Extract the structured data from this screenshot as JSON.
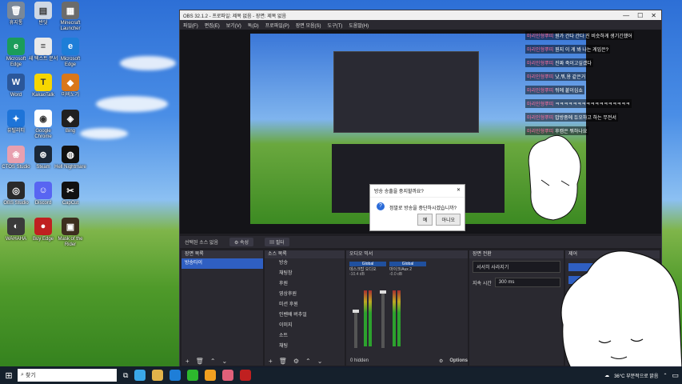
{
  "desktop_icons": [
    {
      "label": "휴지통",
      "color": "#7a8899",
      "glyph": "🗑"
    },
    {
      "label": "반딧",
      "color": "#cfd8e4",
      "glyph": "▤"
    },
    {
      "label": "Minecraft Launcher",
      "color": "#6b6b6b",
      "glyph": "▦"
    },
    {
      "label": "Microsoft Edge",
      "color": "#1b9c5a",
      "glyph": "e"
    },
    {
      "label": "새 텍스트 문서",
      "color": "#e9e9e9",
      "glyph": "≡"
    },
    {
      "label": "Microsoft Edge",
      "color": "#1e7ed8",
      "glyph": "e"
    },
    {
      "label": "Word",
      "color": "#2b579a",
      "glyph": "W"
    },
    {
      "label": "KakaoTalk",
      "color": "#f6d600",
      "glyph": "T"
    },
    {
      "label": "마비노기",
      "color": "#d9771a",
      "glyph": "◆"
    },
    {
      "label": "유틸리티",
      "color": "#1e74d8",
      "glyph": "✦"
    },
    {
      "label": "Google Chrome",
      "color": "#ffffff",
      "glyph": "◉"
    },
    {
      "label": "Bing",
      "color": "#202020",
      "glyph": "◈"
    },
    {
      "label": "CTOS Studio",
      "color": "#e8a0b0",
      "glyph": "❀"
    },
    {
      "label": "Steam",
      "color": "#1b2838",
      "glyph": "⊛"
    },
    {
      "label": "Hell Nightmare",
      "color": "#111111",
      "glyph": "◍"
    },
    {
      "label": "OBS Studio",
      "color": "#2a2a2a",
      "glyph": "◎"
    },
    {
      "label": "Discord",
      "color": "#5865f2",
      "glyph": "☺"
    },
    {
      "label": "CapCut",
      "color": "#111111",
      "glyph": "✂"
    },
    {
      "label": "WAHAHA",
      "color": "#3a3a3a",
      "glyph": "◐"
    },
    {
      "label": "Buy Edge",
      "color": "#c02020",
      "glyph": "●"
    },
    {
      "label": "Mask of the Rider",
      "color": "#3d2e1f",
      "glyph": "▣"
    }
  ],
  "obs": {
    "title": "OBS 32.1.2 - 프로파일: 제목 없음 - 장면: 제목 없음",
    "menu": [
      "파일(F)",
      "편집(E)",
      "보기(V)",
      "독(D)",
      "프로파일(P)",
      "장면 모음(S)",
      "도구(T)",
      "도움말(H)"
    ],
    "dialog": {
      "title": "방송 송출을 중지할까요?",
      "message": "정말로 방송을 중단하시겠습니까?",
      "yes": "예",
      "no": "아니오"
    },
    "chat": [
      {
        "nick": "마리인형뿌띠",
        "text": "뭔가 간다 간다 진 비슷하게 생기긴했어"
      },
      {
        "nick": "마리인형뿌띠",
        "text": "뭔지 이 게 봐 나는 게임은?"
      },
      {
        "nick": "마리인형뿌띠",
        "text": "진짜 죽이고싶겠다"
      },
      {
        "nick": "마리인형뿌띠",
        "text": "낫,뭐,용 같은거"
      },
      {
        "nick": "마리인형뿌띠",
        "text": "뒤에 붙이십쇼"
      },
      {
        "nick": "마리인형뿌띠",
        "text": "ㅋㅋㅋㅋㅋㅋㅋㅋㅋㅋㅋㅋㅋㅋㅋㅋㅋ"
      },
      {
        "nick": "마리인형뿌띠",
        "text": "밥방중에 듀오하고 하는 무전서"
      },
      {
        "nick": "마리인형뿌띠",
        "text": "후캠은 뭐하나요"
      }
    ],
    "source_bar": {
      "selected": "선택된 소스 없음",
      "props": "속성",
      "filters": "필터"
    },
    "scenes": {
      "header": "장면 목록",
      "items": [
        "방송타이"
      ]
    },
    "sources": {
      "header": "소스 목록",
      "items": [
        "방송",
        "채팅창",
        "후원",
        "영상후원",
        "미션 후원",
        "인벤배 버추얼",
        "이미지",
        "소트",
        "채팅"
      ]
    },
    "mixer": {
      "header": "오디오 믹서",
      "channels": [
        {
          "name": "데스크탑 오디오",
          "tag": "Global",
          "db": "-10.4 dB"
        },
        {
          "name": "마이크/Aux 2",
          "tag": "Global",
          "db": "-0.0 dB"
        }
      ],
      "hidden": "0 hidden",
      "options": "Options"
    },
    "transitions": {
      "header": "장면 전환",
      "transition": "서서히 사라지기",
      "duration_label": "지속 시간",
      "duration": "300 ms"
    },
    "controls": {
      "header": "제어"
    }
  },
  "taskbar": {
    "search_placeholder": "찾기",
    "weather": "36°C 부분적으로 맑음",
    "apps": [
      "#3aa7e8",
      "#e2b34a",
      "#1e7ed8",
      "#2db82d",
      "#f0a020",
      "#e0607a",
      "#c02020"
    ]
  }
}
